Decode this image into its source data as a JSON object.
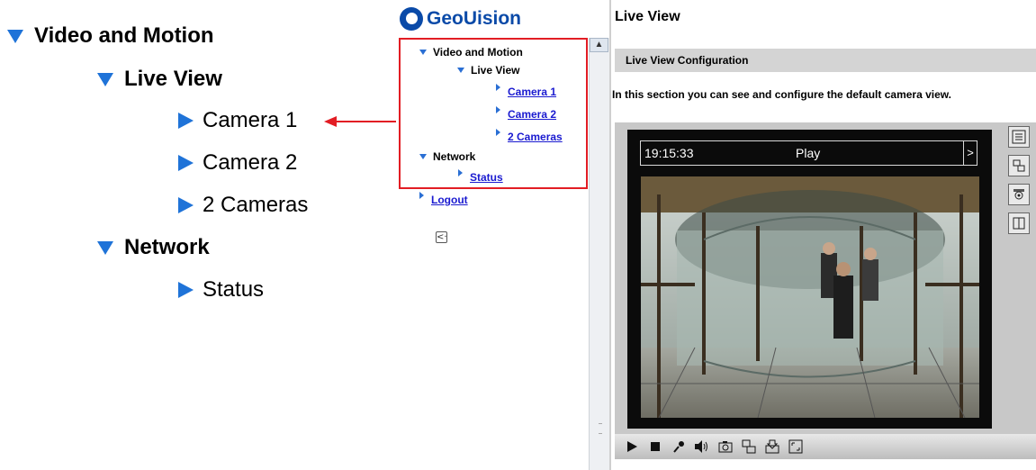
{
  "callout": {
    "items": [
      {
        "label": "Video and Motion"
      },
      {
        "label": "Live View"
      },
      {
        "label": "Camera 1"
      },
      {
        "label": "Camera 2"
      },
      {
        "label": "2 Cameras"
      },
      {
        "label": "Network"
      },
      {
        "label": "Status"
      }
    ]
  },
  "logo": {
    "text": "GeoUision"
  },
  "nav": {
    "video_motion": "Video and Motion",
    "live_view": "Live View",
    "camera1": "Camera 1",
    "camera2": "Camera 2",
    "two_cameras": "2 Cameras",
    "network": "Network",
    "status": "Status",
    "logout": "Logout",
    "collapse_glyph": "<·"
  },
  "content": {
    "title": "Live View",
    "section_header": "Live View Configuration",
    "description": "In this section you can see and configure the default camera view."
  },
  "viewer": {
    "timestamp": "19:15:33",
    "status": "Play",
    "next_glyph": ">"
  },
  "colors": {
    "tree_arrow": "#1f73d8",
    "highlight_box": "#e21d24",
    "link": "#1a1ad0",
    "brand": "#0a4aa8"
  },
  "icons": {
    "side_tools": [
      "list-icon",
      "swap-view-icon",
      "ptz-camera-icon",
      "door-io-icon"
    ],
    "bottom_tools": [
      "play-icon",
      "stop-icon",
      "microphone-icon",
      "speaker-icon",
      "snapshot-icon",
      "switch-view-icon",
      "save-icon",
      "fullscreen-icon"
    ]
  }
}
